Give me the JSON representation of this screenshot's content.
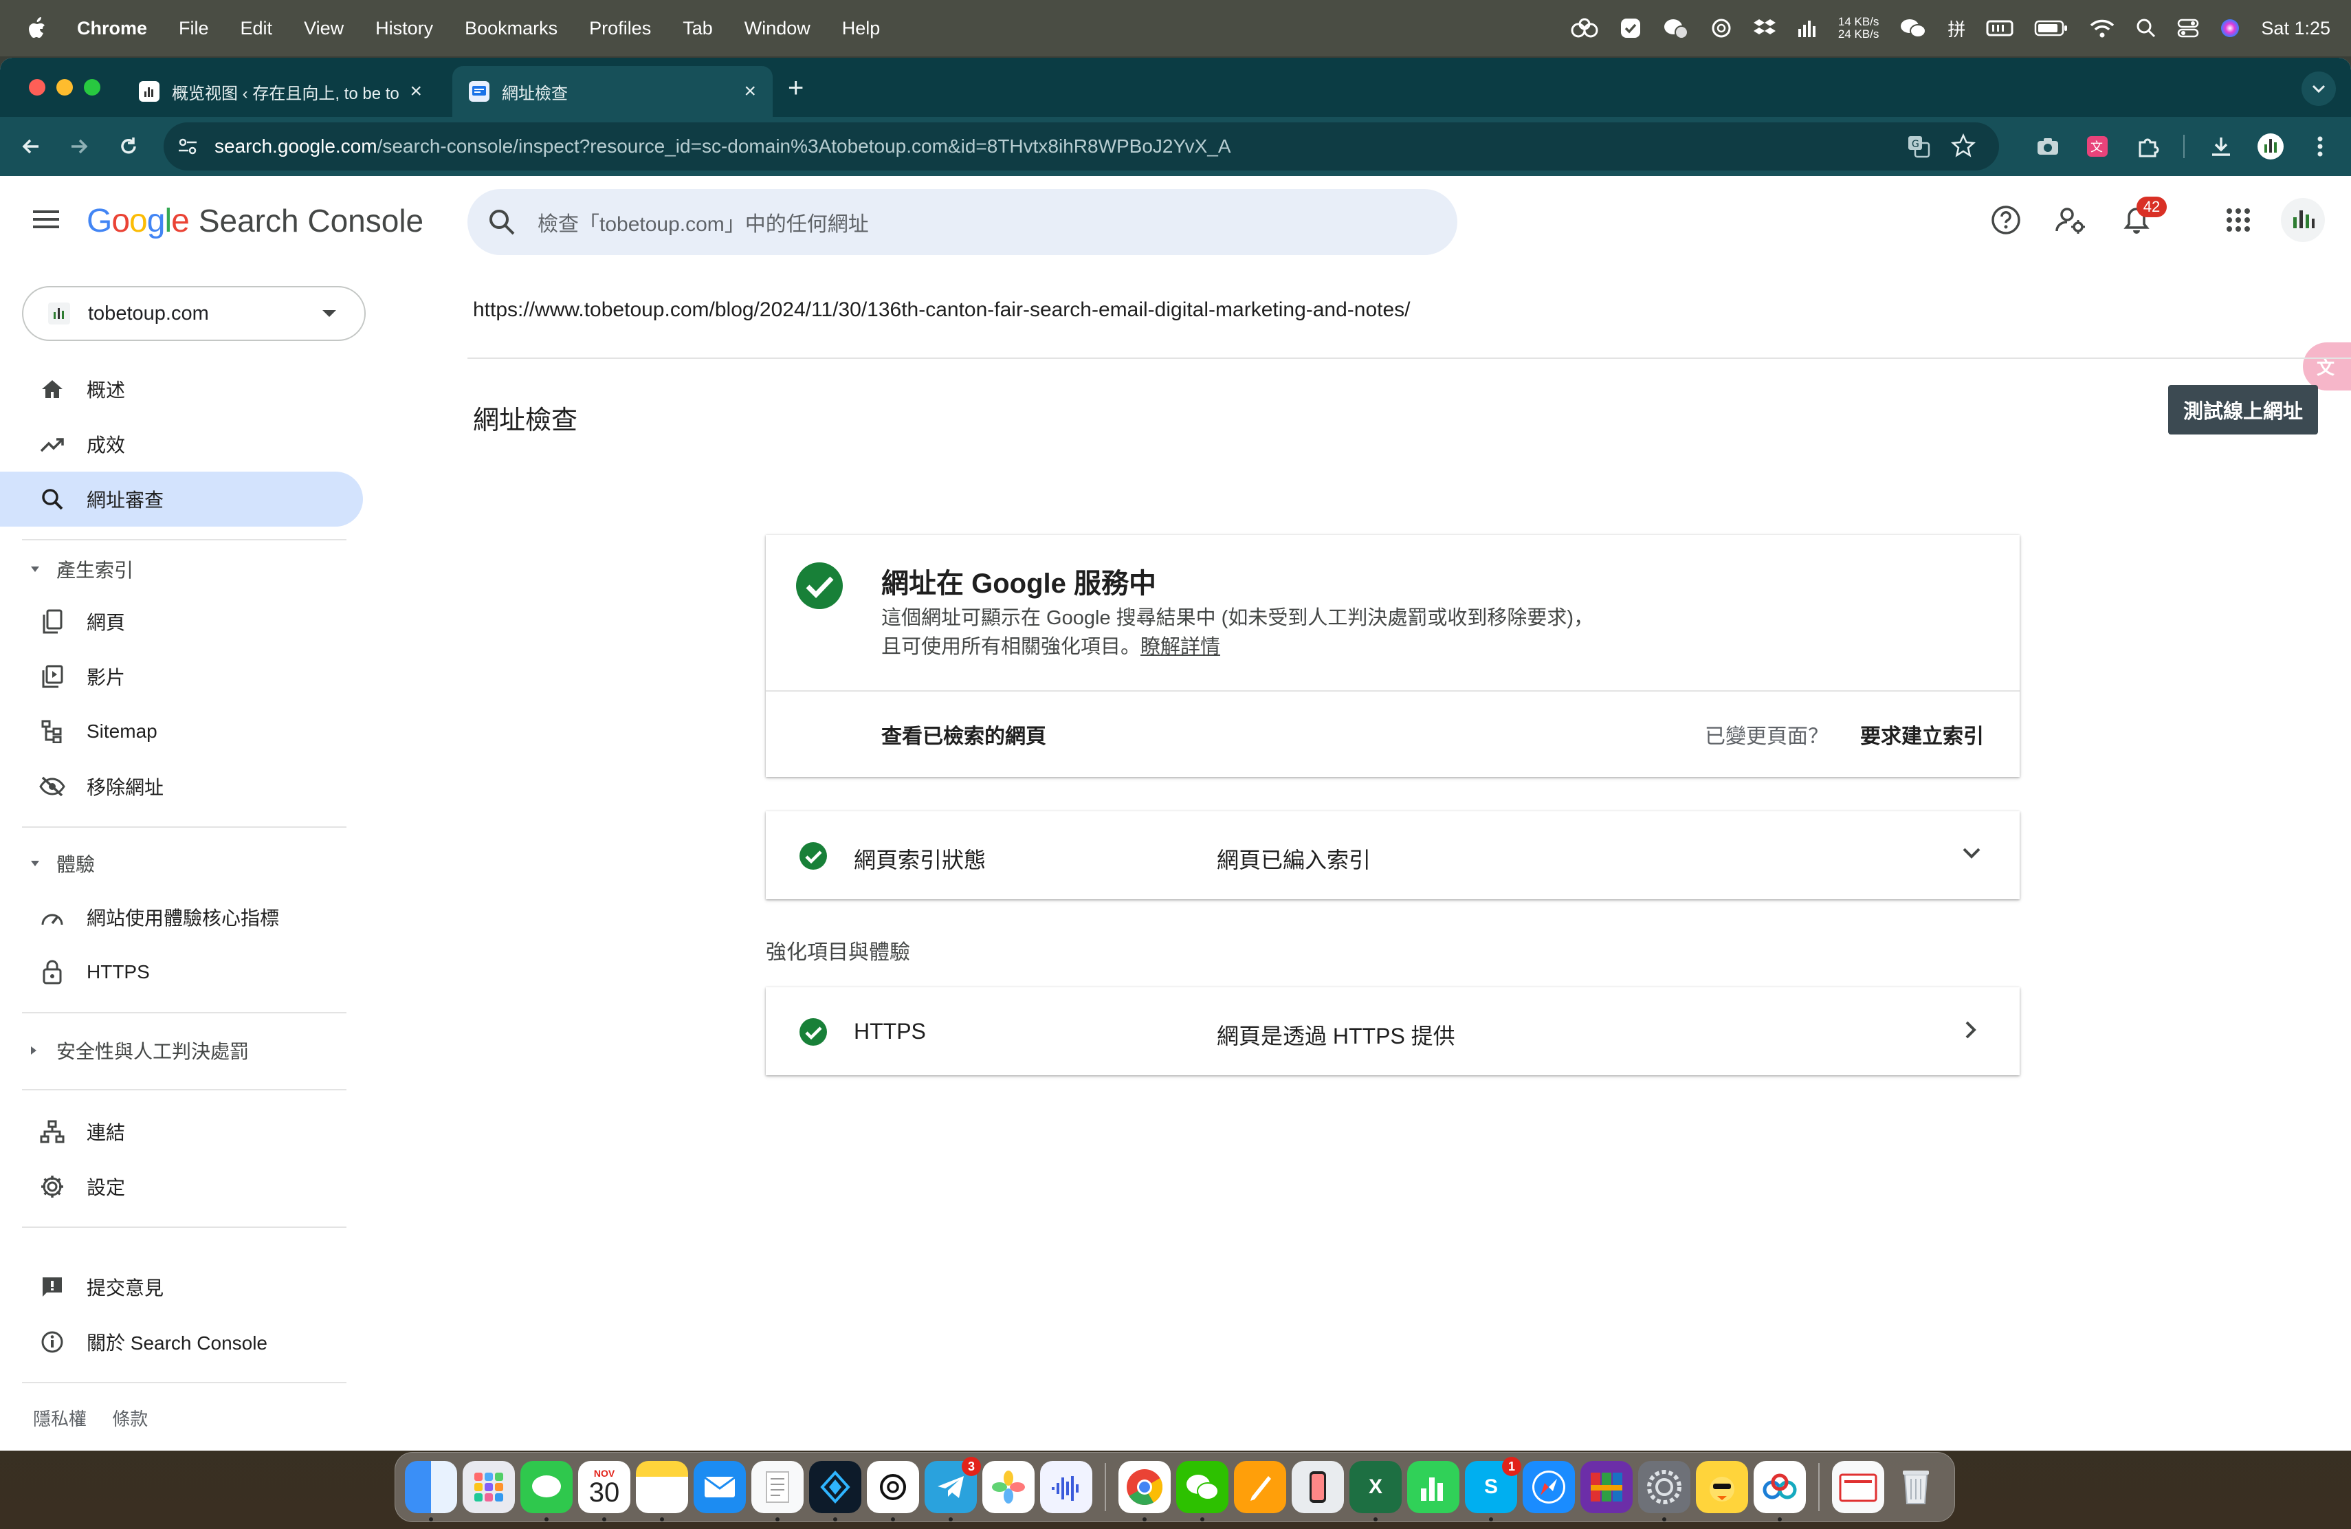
{
  "menubar": {
    "app": "Chrome",
    "items": [
      "File",
      "Edit",
      "View",
      "History",
      "Bookmarks",
      "Profiles",
      "Tab",
      "Window",
      "Help"
    ],
    "net_up": "14 KB/s",
    "net_down": "24 KB/s",
    "clock": "Sat 1:25"
  },
  "browser": {
    "tabs": [
      {
        "title": "概览视图 ‹ 存在且向上, to be to"
      },
      {
        "title": "網址檢查"
      }
    ],
    "url_domain": "search.google.com",
    "url_path": "/search-console/inspect?resource_id=sc-domain%3Atobetoup.com&id=8THvtx8ihR8WPBoJ2YvX_A"
  },
  "header": {
    "logo_google": "Google",
    "logo_product": "Search Console",
    "search_placeholder": "檢查「tobetoup.com」中的任何網址",
    "notification_count": "42"
  },
  "sidebar": {
    "property": "tobetoup.com",
    "nav_top": [
      {
        "label": "概述",
        "icon": "home-icon"
      },
      {
        "label": "成效",
        "icon": "trending-up-icon"
      },
      {
        "label": "網址審查",
        "icon": "search-icon"
      }
    ],
    "section_indexing": "產生索引",
    "nav_indexing": [
      {
        "label": "網頁",
        "icon": "pages-icon"
      },
      {
        "label": "影片",
        "icon": "video-icon"
      },
      {
        "label": "Sitemap",
        "icon": "sitemap-icon"
      },
      {
        "label": "移除網址",
        "icon": "eye-off-icon"
      }
    ],
    "section_experience": "體驗",
    "nav_experience": [
      {
        "label": "網站使用體驗核心指標",
        "icon": "speed-icon"
      },
      {
        "label": "HTTPS",
        "icon": "lock-icon"
      }
    ],
    "section_security": "安全性與人工判決處罰",
    "nav_other": [
      {
        "label": "連結",
        "icon": "links-icon"
      },
      {
        "label": "設定",
        "icon": "gear-icon"
      }
    ],
    "nav_bottom": [
      {
        "label": "提交意見",
        "icon": "feedback-icon"
      },
      {
        "label": "關於 Search Console",
        "icon": "info-icon"
      }
    ],
    "footer_privacy": "隱私權",
    "footer_terms": "條款"
  },
  "main": {
    "inspected_url": "https://www.tobetoup.com/blog/2024/11/30/136th-canton-fair-search-email-digital-marketing-and-notes/",
    "page_title": "網址檢查",
    "test_live_button": "測試線上網址",
    "status_card": {
      "title": "網址在 Google 服務中",
      "desc_line1": "這個網址可顯示在 Google 搜尋結果中 (如未受到人工判決處罰或收到移除要求)，",
      "desc_line2": "且可使用所有相關強化項目。",
      "learn_more": "瞭解詳情",
      "view_crawled": "查看已檢索的網頁",
      "changed_page": "已變更頁面？",
      "request_indexing": "要求建立索引"
    },
    "index_row": {
      "label": "網頁索引狀態",
      "value": "網頁已編入索引"
    },
    "enhancements_title": "強化項目與體驗",
    "https_row": {
      "label": "HTTPS",
      "value": "網頁是透過 HTTPS 提供"
    }
  },
  "dock": {
    "calendar_month": "NOV",
    "calendar_day": "30",
    "telegram_badge": "3",
    "skype_badge": "1"
  },
  "colors": {
    "accent_blue": "#1a73e8",
    "success_green": "#188038",
    "nav_active": "#d3e3fd",
    "tabstrip": "#0b3c44",
    "toolbar": "#175059"
  }
}
